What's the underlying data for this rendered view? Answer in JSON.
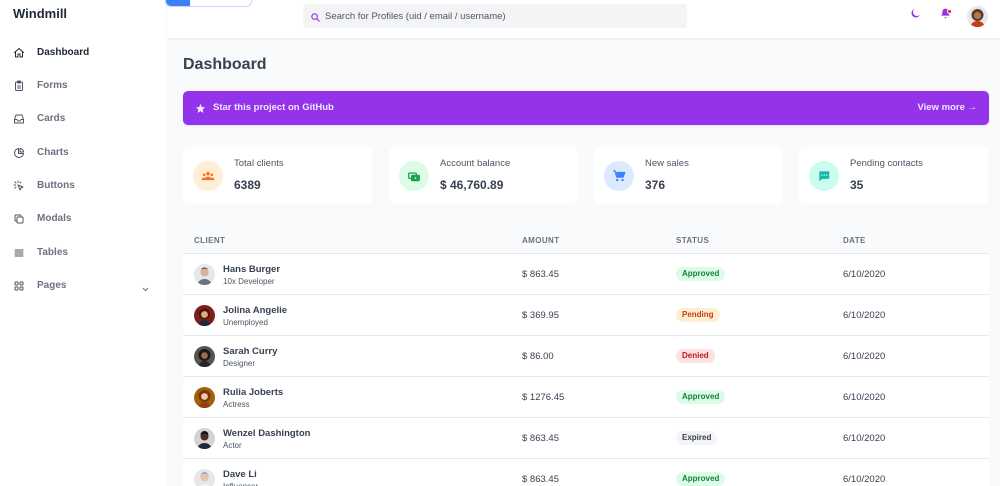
{
  "app": {
    "name": "Windmill"
  },
  "sidebar": {
    "items": [
      {
        "label": "Dashboard",
        "icon": "home-icon",
        "active": true
      },
      {
        "label": "Forms",
        "icon": "clipboard-icon"
      },
      {
        "label": "Cards",
        "icon": "inbox-icon"
      },
      {
        "label": "Charts",
        "icon": "pie-chart-icon"
      },
      {
        "label": "Buttons",
        "icon": "cursor-click-icon"
      },
      {
        "label": "Modals",
        "icon": "duplicate-icon"
      },
      {
        "label": "Tables",
        "icon": "list-icon"
      },
      {
        "label": "Pages",
        "icon": "grid-icon",
        "has_dropdown": true
      }
    ]
  },
  "header": {
    "search_placeholder": "Search for Profiles (uid / email / username)",
    "icons": [
      "moon-icon",
      "bell-icon",
      "profile-avatar"
    ]
  },
  "main": {
    "title": "Dashboard",
    "banner": {
      "text": "Star this project on GitHub",
      "link": "View more →",
      "color": "#9333ea"
    },
    "cards": [
      {
        "label": "Total clients",
        "value": "6389",
        "icon": "users-icon",
        "bg": "#ffedd5",
        "fg": "#f97316"
      },
      {
        "label": "Account balance",
        "value": "$ 46,760.89",
        "icon": "cash-icon",
        "bg": "#dcfce7",
        "fg": "#16a34a"
      },
      {
        "label": "New sales",
        "value": "376",
        "icon": "cart-icon",
        "bg": "#dbeafe",
        "fg": "#3b82f6"
      },
      {
        "label": "Pending contacts",
        "value": "35",
        "icon": "chat-icon",
        "bg": "#ccfbf1",
        "fg": "#14b8a6"
      }
    ]
  },
  "table": {
    "headers": [
      "CLIENT",
      "AMOUNT",
      "STATUS",
      "DATE"
    ],
    "rows": [
      {
        "name": "Hans Burger",
        "role": "10x Developer",
        "amount": "$ 863.45",
        "status": "Approved",
        "date": "6/10/2020"
      },
      {
        "name": "Jolina Angelie",
        "role": "Unemployed",
        "amount": "$ 369.95",
        "status": "Pending",
        "date": "6/10/2020"
      },
      {
        "name": "Sarah Curry",
        "role": "Designer",
        "amount": "$ 86.00",
        "status": "Denied",
        "date": "6/10/2020"
      },
      {
        "name": "Rulia Joberts",
        "role": "Actress",
        "amount": "$ 1276.45",
        "status": "Approved",
        "date": "6/10/2020"
      },
      {
        "name": "Wenzel Dashington",
        "role": "Actor",
        "amount": "$ 863.45",
        "status": "Expired",
        "date": "6/10/2020"
      },
      {
        "name": "Dave Li",
        "role": "Influencer",
        "amount": "$ 863.45",
        "status": "Approved",
        "date": "6/10/2020"
      }
    ]
  }
}
